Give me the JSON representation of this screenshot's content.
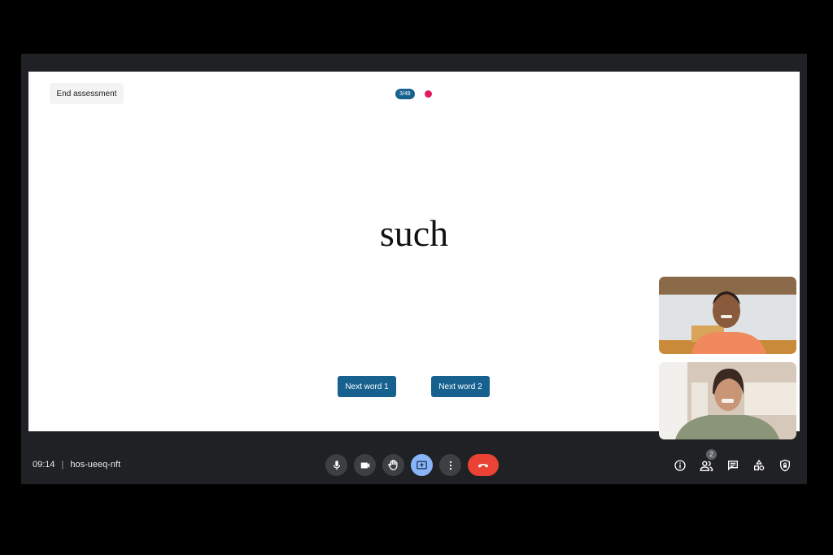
{
  "assessment": {
    "end_label": "End assessment",
    "progress": "3/48",
    "current_word": "such",
    "next_buttons": [
      "Next word 1",
      "Next word 2"
    ],
    "record_color": "#e21b5b",
    "accent": "#17618f"
  },
  "participants": [
    {
      "name": "participant-child-video"
    },
    {
      "name": "participant-adult-video"
    }
  ],
  "meeting": {
    "time": "09:14",
    "separator": "|",
    "code": "hos-ueeq-nft",
    "participant_count": "2"
  },
  "controls": {
    "icons": [
      "microphone-icon",
      "camera-icon",
      "raise-hand-icon",
      "present-screen-icon",
      "more-options-icon",
      "end-call-icon"
    ],
    "right_icons": [
      "info-icon",
      "people-icon",
      "chat-icon",
      "activities-icon",
      "host-controls-icon"
    ]
  }
}
